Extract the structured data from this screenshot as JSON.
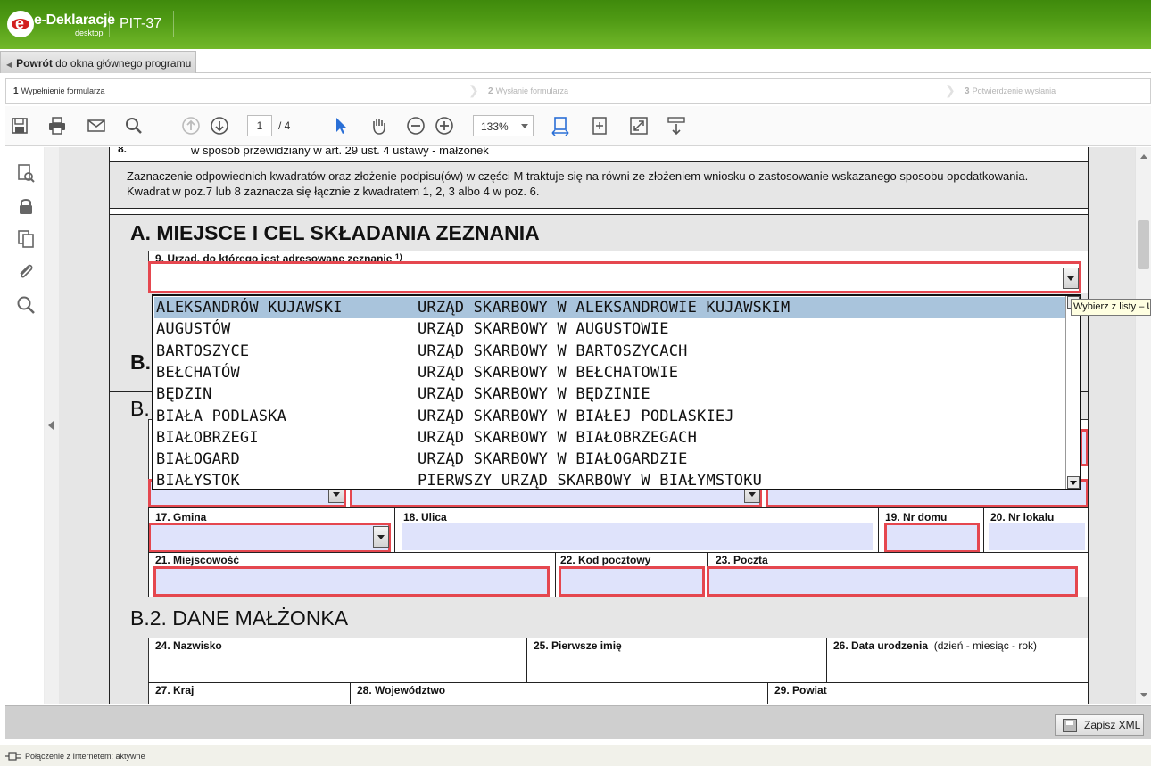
{
  "app": {
    "name": "e-Deklaracje",
    "sub": "desktop",
    "form": "PIT-37",
    "back_bold": "Powrót",
    "back_rest": " do okna głównego programu"
  },
  "steps": [
    {
      "num": "1",
      "label": "Wypełnienie formularza"
    },
    {
      "num": "2",
      "label": "Wysłanie formularza"
    },
    {
      "num": "3",
      "label": "Potwierdzenie wysłania"
    }
  ],
  "toolbar": {
    "page": "1",
    "total": "/ 4",
    "zoom": "133%"
  },
  "document": {
    "row8_num": "8.",
    "row8_text": "w sposób przewidziany w art. 29 ust. 4 ustawy - małżonek",
    "note": "Zaznaczenie odpowiednich kwadratów oraz złożenie podpisu(ów) w części M traktuje się na równi ze złożeniem wniosku o zastosowanie wskazanego sposobu opodatkowania. Kwadrat w poz.7 lub 8 zaznacza się łącznie z kwadratem 1, 2, 3 albo 4 w poz. 6.",
    "section_a": "A. MIEJSCE I CEL SKŁADANIA ZEZNANIA",
    "field9": "9. Urząd, do którego jest adresowane zeznanie",
    "field9_sup": "1)",
    "section_b_partial": "B.",
    "section_b1_partial": "B.",
    "field17": "17. Gmina",
    "field18": "18. Ulica",
    "field19": "19. Nr domu",
    "field20": "20. Nr lokalu",
    "field21": "21. Miejscowość",
    "field22": "22. Kod pocztowy",
    "field23": "23. Poczta",
    "section_b2": "B.2. DANE MAŁŻONKA",
    "field24": "24. Nazwisko",
    "field25": "25. Pierwsze imię",
    "field26": "26. Data urodzenia",
    "field26_hint": "(dzień - miesiąc - rok)",
    "field27": "27. Kraj",
    "field28": "28. Województwo",
    "field29": "29. Powiat"
  },
  "dropdown": {
    "tooltip": "Wybierz z listy – U",
    "items": [
      {
        "city": "ALEKSANDRÓW KUJAWSKI",
        "office": "URZĄD SKARBOWY W ALEKSANDROWIE KUJAWSKIM"
      },
      {
        "city": "AUGUSTÓW",
        "office": "URZĄD SKARBOWY W AUGUSTOWIE"
      },
      {
        "city": "BARTOSZYCE",
        "office": "URZĄD SKARBOWY W BARTOSZYCACH"
      },
      {
        "city": "BEŁCHATÓW",
        "office": "URZĄD SKARBOWY W BEŁCHATOWIE"
      },
      {
        "city": "BĘDZIN",
        "office": "URZĄD SKARBOWY W BĘDZINIE"
      },
      {
        "city": "BIAŁA PODLASKA",
        "office": "URZĄD SKARBOWY W BIAŁEJ PODLASKIEJ"
      },
      {
        "city": "BIAŁOBRZEGI",
        "office": "URZĄD SKARBOWY W BIAŁOBRZEGACH"
      },
      {
        "city": "BIAŁOGARD",
        "office": "URZĄD SKARBOWY W BIAŁOGARDZIE"
      },
      {
        "city": "BIAŁYSTOK",
        "office": "PIERWSZY URZĄD SKARBOWY W BIAŁYMSTOKU"
      }
    ]
  },
  "bottom": {
    "save": "Zapisz XML",
    "status": "Połączenie z Internetem: aktywne"
  },
  "colors": {
    "brand_green": "#4f9a14",
    "required_border": "#e5474f",
    "field_fill": "#dfe3fb",
    "selected_row": "#a9c4dc"
  }
}
